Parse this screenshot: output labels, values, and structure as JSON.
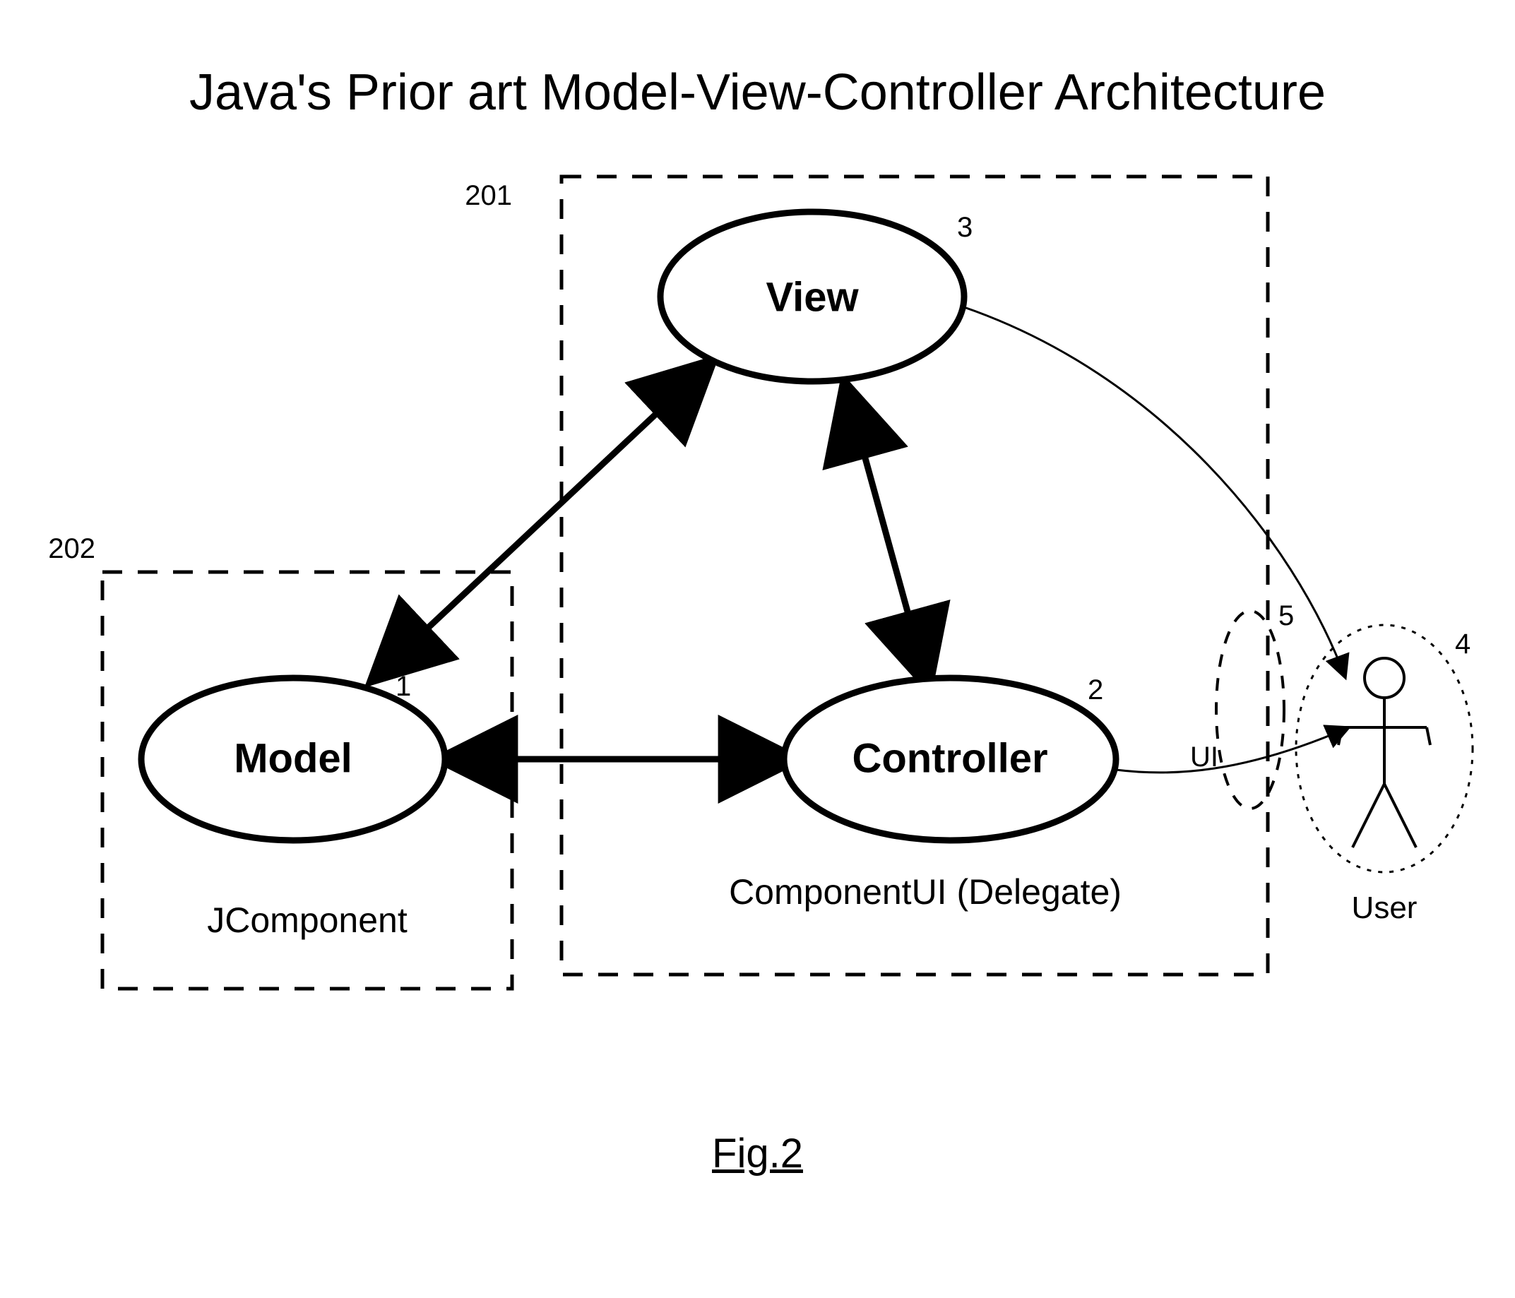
{
  "title": "Java's Prior art Model-View-Controller Architecture",
  "figure_label": "Fig.2",
  "nodes": {
    "model": {
      "label": "Model",
      "num": "1"
    },
    "view": {
      "label": "View",
      "num": "3"
    },
    "controller": {
      "label": "Controller",
      "num": "2"
    }
  },
  "boxes": {
    "jcomponent": {
      "label": "JComponent",
      "num": "202"
    },
    "componentui": {
      "label": "ComponentUI (Delegate)",
      "num": "201"
    }
  },
  "user": {
    "label": "User",
    "num": "4"
  },
  "ui_boundary": {
    "num": "5",
    "label": "UI"
  }
}
